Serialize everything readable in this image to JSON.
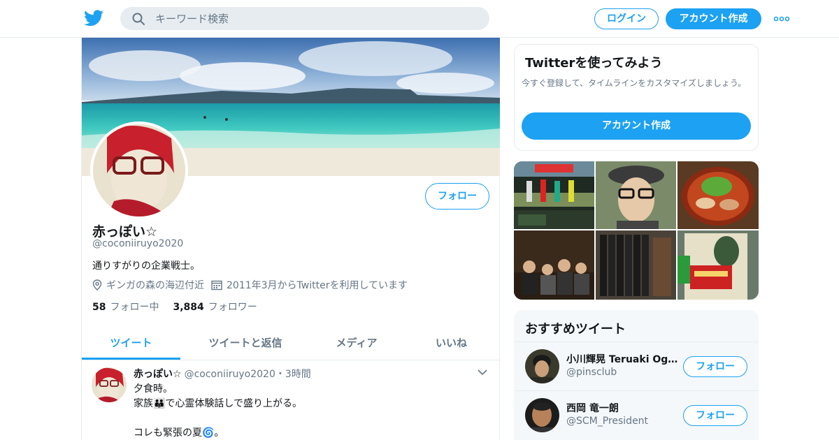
{
  "topbar": {
    "search_placeholder": "キーワード検索",
    "login_label": "ログイン",
    "signup_label": "アカウント作成"
  },
  "profile": {
    "name": "赤っぽい☆",
    "handle": "@coconiiruyo2020",
    "bio": "通りすがりの企業戦士。",
    "location": "ギンガの森の海辺付近",
    "joined": "2011年3月からTwitterを利用しています",
    "following_count": "58",
    "following_label": "フォロー中",
    "followers_count": "3,884",
    "followers_label": "フォロワー",
    "follow_label": "フォロー"
  },
  "tabs": [
    {
      "label": "ツイート"
    },
    {
      "label": "ツイートと返信"
    },
    {
      "label": "メディア"
    },
    {
      "label": "いいね"
    }
  ],
  "tweet": {
    "name": "赤っぽい☆",
    "handle": "@coconiiruyo2020",
    "time": "・3時間",
    "lines": [
      "夕食時。",
      "家族👪で心霊体験話しで盛り上がる。",
      "",
      "コレも緊張の夏🌀。"
    ]
  },
  "signup_card": {
    "title": "Twitterを使ってみよう",
    "desc": "今すぐ登録して、タイムラインをカスタマイズしましょう。",
    "button": "アカウント作成"
  },
  "recommended": {
    "title": "おすすめツイート",
    "items": [
      {
        "name": "小川輝晃 Teruaki Ogawa",
        "handle": "@pinsclub",
        "button": "フォロー"
      },
      {
        "name": "西岡 竜一朗",
        "handle": "@SCM_President",
        "button": "フォロー"
      }
    ]
  },
  "colors": {
    "accent": "#1da1f2",
    "text": "#14171a",
    "muted": "#657786",
    "border": "#e6ecf0"
  }
}
